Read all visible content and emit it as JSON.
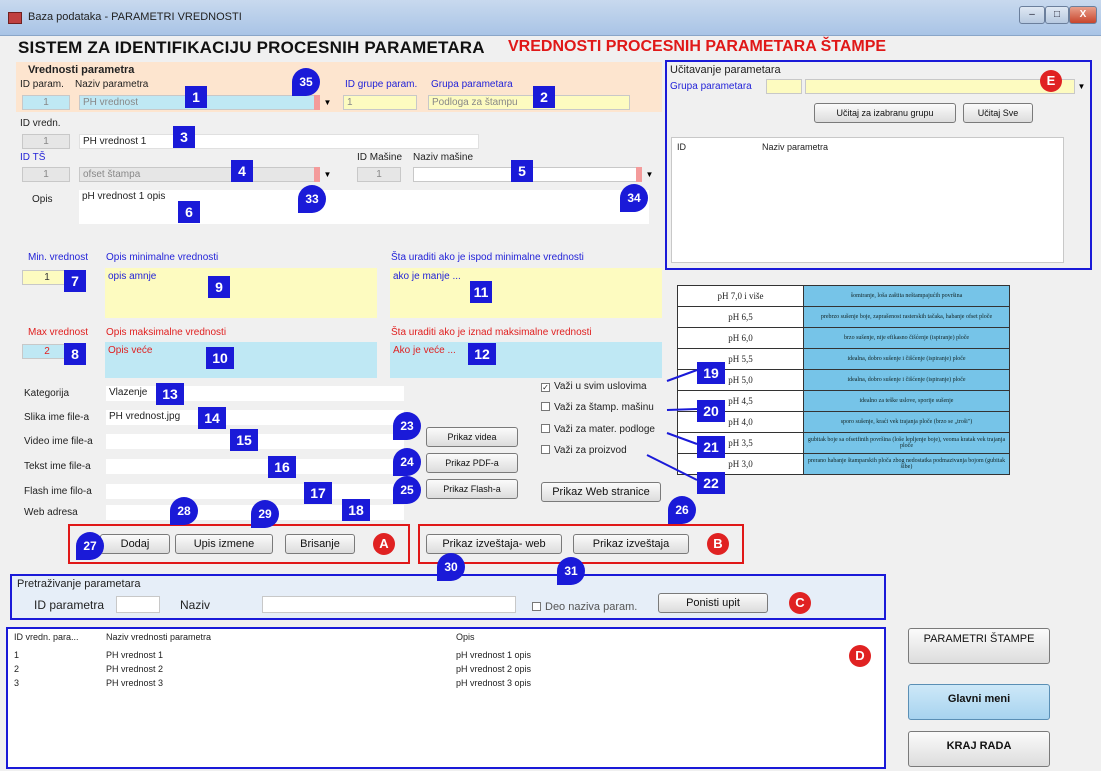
{
  "window": {
    "title": "Baza podataka - PARAMETRI VREDNOSTI",
    "controls": {
      "minimize": "–",
      "maximize": "□",
      "close": "X"
    }
  },
  "header": {
    "title": "SISTEM ZA IDENTIFIKACIJU PROCESNIH PARAMETARA",
    "subtitle": "VREDNOSTI PROCESNIH PARAMETARA ŠTAMPE"
  },
  "values_panel": {
    "heading": "Vrednosti parametra",
    "id_param_label": "ID param.",
    "id_param_value": "1",
    "naziv_parametra_label": "Naziv parametra",
    "naziv_parametra_value": "PH vrednost",
    "id_grupe_label": "ID grupe param.",
    "id_grupe_value": "1",
    "grupa_label": "Grupa parametara",
    "grupa_value": "Podloga za štampu",
    "id_vredn_label": "ID vredn.",
    "id_vredn_value": "1",
    "vrednost_naziv": "PH vrednost 1",
    "id_ts_label": "ID TŠ",
    "id_ts_value": "1",
    "ts_value": "ofset štampa",
    "id_masine_label": "ID Mašine",
    "id_masine_value": "1",
    "naziv_masine_label": "Naziv mašine",
    "naziv_masine_value": "",
    "opis_label": "Opis",
    "opis_value": "pH vrednost 1 opis"
  },
  "minmax": {
    "min_label": "Min. vrednost",
    "min_value": "1",
    "opis_min_label": "Opis minimalne vrednosti",
    "opis_min_value": "opis amnje",
    "sta_min_label": "Šta uraditi ako je ispod minimalne vrednosti",
    "sta_min_value": "ako je manje ...",
    "max_label": "Max vrednost",
    "max_value": "2",
    "opis_max_label": "Opis maksimalne vrednosti",
    "opis_max_value": "Opis veće",
    "sta_max_label": "Šta uraditi ako je iznad maksimalne vrednosti",
    "sta_max_value": "Ako je veće ..."
  },
  "files": {
    "kategorija_label": "Kategorija",
    "kategorija_value": "Vlazenje",
    "slika_label": "Slika ime file-a",
    "slika_value": "PH vrednost.jpg",
    "video_label": "Video ime file-a",
    "tekst_label": "Tekst ime file-a",
    "flash_label": "Flash ime filo-a",
    "web_label": "Web adresa"
  },
  "media_buttons": {
    "video": "Prikaz videa",
    "pdf": "Prikaz PDF-a",
    "flash": "Prikaz Flash-a",
    "web": "Prikaz Web stranice"
  },
  "checks": [
    {
      "label": "Važi u svim uslovima",
      "checked": true
    },
    {
      "label": "Važi za štamp. mašinu",
      "checked": false
    },
    {
      "label": "Važi za mater. podloge",
      "checked": false
    },
    {
      "label": "Važi za proizvod",
      "checked": false
    }
  ],
  "ph_table": [
    {
      "ph": "pH 7,0 i više",
      "desc": "ŝomiranje, loša zaštita neštampajućih površina"
    },
    {
      "ph": "pH 6,5",
      "desc": "prebrzo sušenje boje, zaprašenost rasterskih tačaka, habanje ofset ploče"
    },
    {
      "ph": "pH 6,0",
      "desc": "brzo sušenje, nije efikasno čišćenje (ispiranje) ploče"
    },
    {
      "ph": "pH 5,5",
      "desc": "idealna, dobro sušenje i čišćenje (ispiranje) ploče"
    },
    {
      "ph": "pH 5,0",
      "desc": "idealna, dobro sušenje i čišćenje (ispiranje) ploče"
    },
    {
      "ph": "pH 4,5",
      "desc": "idealno za teške uslove, sporije sušenje"
    },
    {
      "ph": "pH 4,0",
      "desc": "sporo sušenje, kraći vek trajanja ploče (brzo se „troši\")"
    },
    {
      "ph": "pH 3,5",
      "desc": "gubitak boje sa ofsetfinih površina (loše lepljenje boje), veoma kratak vek trajanja ploče"
    },
    {
      "ph": "pH 3,0",
      "desc": "prerano habanje štamparskih ploča zbog nedostatka podmazivanja bojom (gubitak šibe)"
    }
  ],
  "loading_panel": {
    "heading": "Učitavanje parametara",
    "grupa_label": "Grupa parametara",
    "btn_group": "Učitaj za izabranu grupu",
    "btn_all": "Učitaj Sve",
    "col_id": "ID",
    "col_naziv": "Naziv parametra"
  },
  "actions": {
    "dodaj": "Dodaj",
    "upis": "Upis izmene",
    "brisanje": "Brisanje",
    "izvestaj_web": "Prikaz izveštaja- web",
    "izvestaj": "Prikaz izveštaja"
  },
  "search": {
    "heading": "Pretraživanje parametara",
    "id_label": "ID parametra",
    "naziv_label": "Naziv",
    "deo_label": "Deo naziva param.",
    "ponisti": "Ponisti upit"
  },
  "grid": {
    "columns": [
      "ID vredn. para...",
      "Naziv vrednosti parametra",
      "Opis"
    ],
    "rows": [
      [
        "1",
        "PH vrednost 1",
        "pH vrednost 1 opis"
      ],
      [
        "2",
        "PH vrednost 2",
        "pH vrednost 2 opis"
      ],
      [
        "3",
        "PH vrednost 3",
        "pH vrednost 3 opis"
      ]
    ]
  },
  "side_buttons": {
    "parametri": "PARAMETRI ŠTAMPE",
    "glavni": "Glavni meni",
    "kraj": "KRAJ RADA"
  },
  "markers": {
    "n1": "1",
    "n2": "2",
    "n3": "3",
    "n4": "4",
    "n5": "5",
    "n6": "6",
    "n7": "7",
    "n8": "8",
    "n9": "9",
    "n10": "10",
    "n11": "11",
    "n12": "12",
    "n13": "13",
    "n14": "14",
    "n15": "15",
    "n16": "16",
    "n17": "17",
    "n18": "18",
    "n19": "19",
    "n20": "20",
    "n21": "21",
    "n22": "22",
    "d23": "23",
    "d24": "24",
    "d25": "25",
    "d26": "26",
    "d27": "27",
    "d28": "28",
    "d29": "29",
    "d30": "30",
    "d31": "31",
    "d33": "33",
    "d34": "34",
    "d35": "35",
    "A": "A",
    "B": "B",
    "C": "C",
    "D": "D",
    "E": "E"
  },
  "colors": {
    "accent_blue": "#1a1ad8",
    "accent_red": "#e01818",
    "param_panel_bg": "#fde5cf",
    "loading_panel_bg": "#cfeefb",
    "min_bg": "#fdfbc0",
    "max_bg": "#bfe8f4"
  }
}
